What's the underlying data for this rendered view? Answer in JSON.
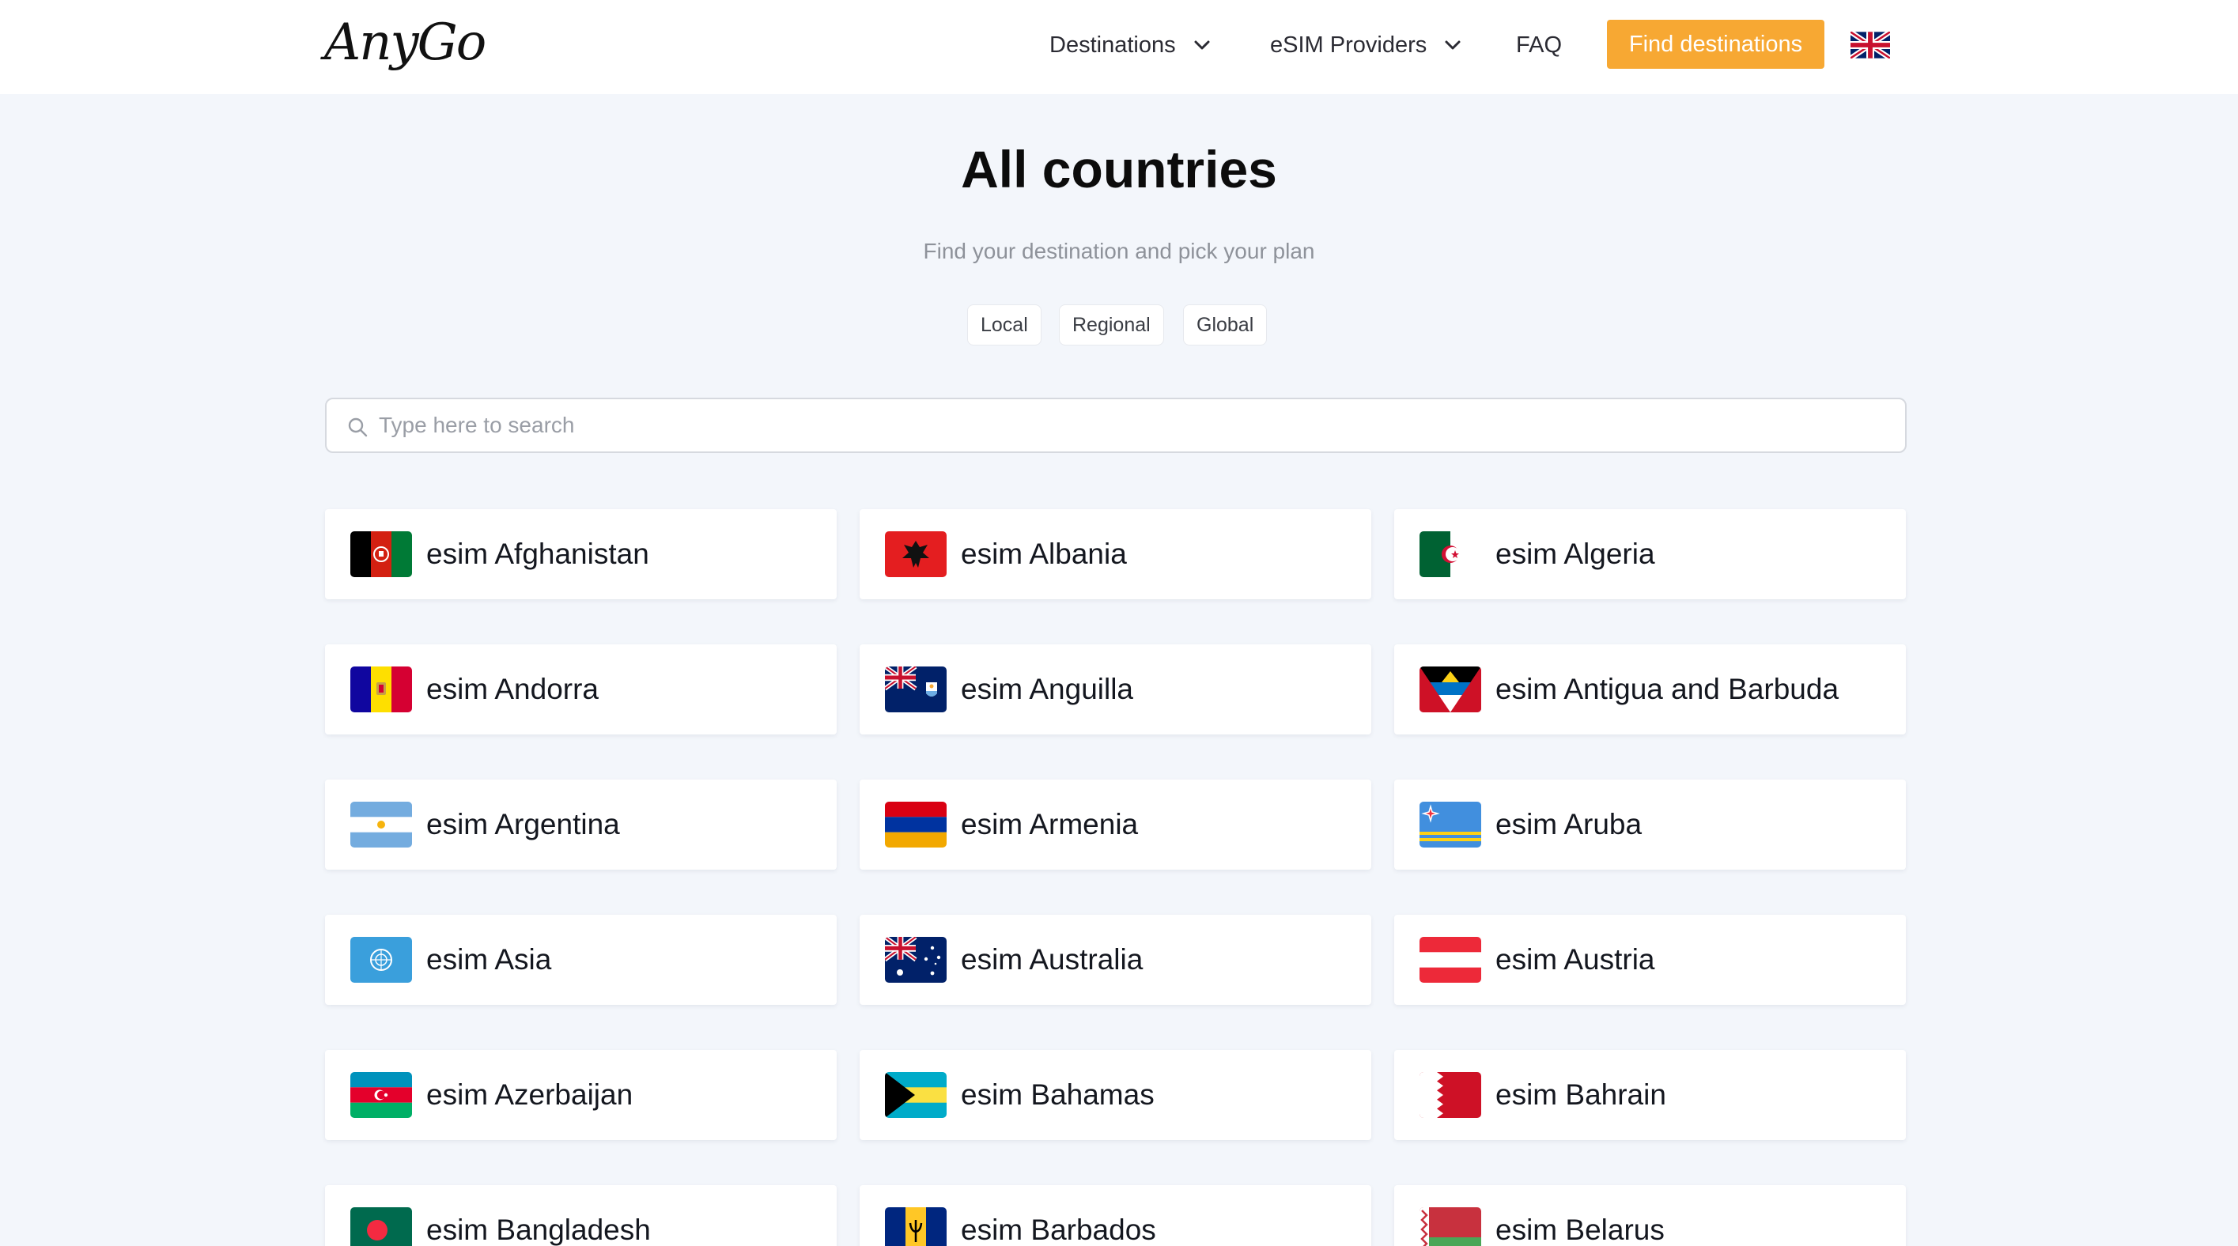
{
  "header": {
    "logo": "AnyGo",
    "nav": {
      "destinations": "Destinations",
      "providers": "eSIM Providers",
      "faq": "FAQ"
    },
    "cta": "Find destinations",
    "language_icon": "uk-flag-icon"
  },
  "hero": {
    "title": "All countries",
    "subtitle": "Find your destination and pick your plan",
    "filters": [
      "Local",
      "Regional",
      "Global"
    ]
  },
  "search": {
    "placeholder": "Type here to search"
  },
  "colors": {
    "accent": "#f7a833",
    "background": "#f3f6fb"
  },
  "countries": [
    {
      "label": "esim Afghanistan",
      "flag": "afghanistan"
    },
    {
      "label": "esim Albania",
      "flag": "albania"
    },
    {
      "label": "esim Algeria",
      "flag": "algeria"
    },
    {
      "label": "esim Andorra",
      "flag": "andorra"
    },
    {
      "label": "esim Anguilla",
      "flag": "anguilla"
    },
    {
      "label": "esim Antigua and Barbuda",
      "flag": "antigua"
    },
    {
      "label": "esim Argentina",
      "flag": "argentina"
    },
    {
      "label": "esim Armenia",
      "flag": "armenia"
    },
    {
      "label": "esim Aruba",
      "flag": "aruba"
    },
    {
      "label": "esim Asia",
      "flag": "asia"
    },
    {
      "label": "esim Australia",
      "flag": "australia"
    },
    {
      "label": "esim Austria",
      "flag": "austria"
    },
    {
      "label": "esim Azerbaijan",
      "flag": "azerbaijan"
    },
    {
      "label": "esim Bahamas",
      "flag": "bahamas"
    },
    {
      "label": "esim Bahrain",
      "flag": "bahrain"
    },
    {
      "label": "esim Bangladesh",
      "flag": "bangladesh"
    },
    {
      "label": "esim Barbados",
      "flag": "barbados"
    },
    {
      "label": "esim Belarus",
      "flag": "belarus"
    }
  ]
}
